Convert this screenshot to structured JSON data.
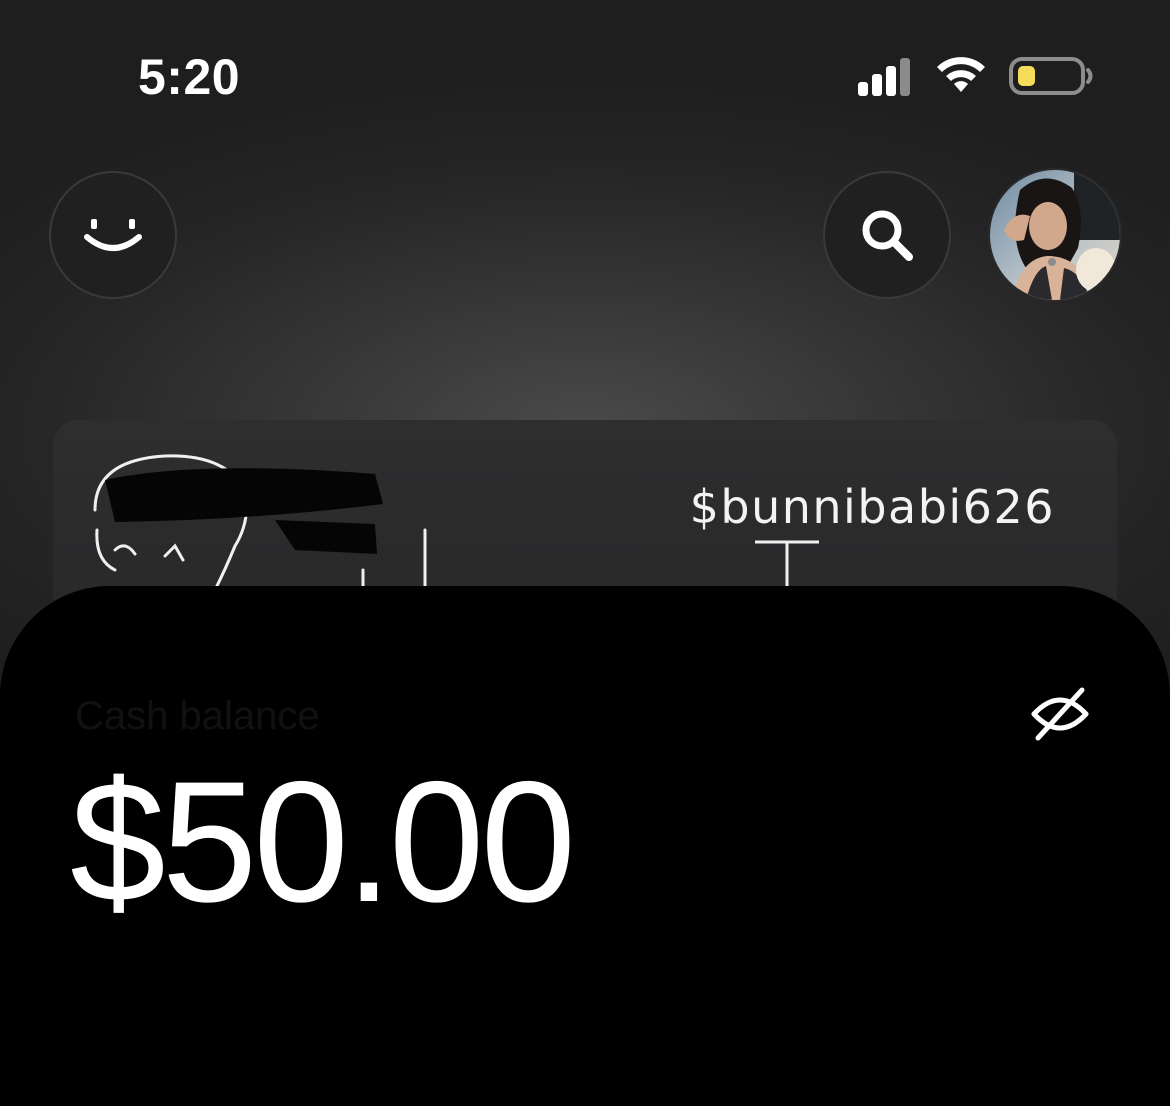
{
  "status_bar": {
    "time": "5:20",
    "icons": [
      "cellular-signal-icon",
      "wifi-icon",
      "battery-icon"
    ],
    "battery_color": "#f5dc5a"
  },
  "header": {
    "left_button_icon": "smiley-face-icon",
    "search_button_icon": "search-icon",
    "avatar": "profile-photo"
  },
  "card": {
    "cashtag": "$bunnibabi626"
  },
  "balance": {
    "label": "Cash balance",
    "amount": "$50.00",
    "visibility_icon": "eye-slash-icon"
  },
  "colors": {
    "background": "#2b2b2c",
    "sheet": "#000000",
    "text": "#ffffff"
  }
}
